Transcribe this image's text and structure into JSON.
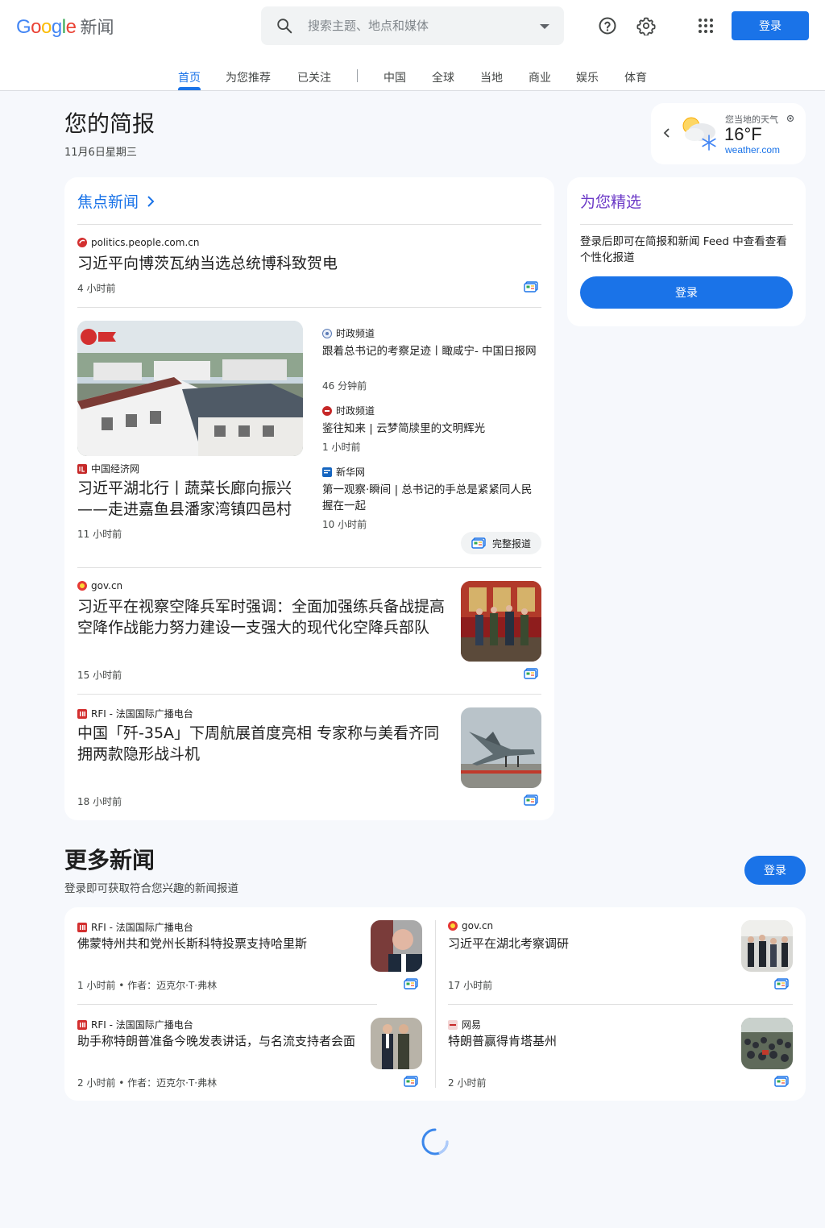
{
  "header": {
    "logo_text": "Google",
    "logo_sub": "新闻",
    "search_placeholder": "搜索主题、地点和媒体",
    "signin_label": "登录"
  },
  "tabs": [
    {
      "label": "首页",
      "active": true
    },
    {
      "label": "为您推荐"
    },
    {
      "label": "已关注"
    },
    {
      "label": "中国"
    },
    {
      "label": "全球"
    },
    {
      "label": "当地"
    },
    {
      "label": "商业"
    },
    {
      "label": "娱乐"
    },
    {
      "label": "体育"
    }
  ],
  "briefing": {
    "title": "您的简报",
    "date": "11月6日星期三"
  },
  "weather": {
    "label": "您当地的天气",
    "temp": "16°F",
    "source": "weather.com"
  },
  "top_stories": {
    "section_label": "焦点新闻",
    "story1": {
      "source": "politics.people.com.cn",
      "headline": "习近平向博茨瓦纳当选总统博科致贺电",
      "time": "4 小时前"
    },
    "cluster": {
      "main": {
        "source": "中国经济网",
        "headline": "习近平湖北行丨蔬菜长廊向振兴——走进嘉鱼县潘家湾镇四邑村",
        "time": "11 小时前"
      },
      "related": [
        {
          "source": "时政频道",
          "headline": "跟着总书记的考察足迹丨瞰咸宁- 中国日报网",
          "time": "46 分钟前"
        },
        {
          "source": "时政频道",
          "headline": "鉴往知来 | 云梦简牍里的文明辉光",
          "time": "1 小时前"
        },
        {
          "source": "新华网",
          "headline": "第一观察·瞬间 | 总书记的手总是紧紧同人民握在一起",
          "time": "10 小时前"
        }
      ],
      "full_coverage": "完整报道"
    },
    "story3": {
      "source": "gov.cn",
      "headline": "习近平在视察空降兵军时强调：全面加强练兵备战提高空降作战能力努力建设一支强大的现代化空降兵部队",
      "time": "15 小时前"
    },
    "story4": {
      "source": "RFI - 法国国际广播电台",
      "headline": "中国「歼-35A」下周航展首度亮相 专家称与美看齐同拥两款隐形战斗机",
      "time": "18 小时前"
    }
  },
  "picks": {
    "title": "为您精选",
    "text": "登录后即可在简报和新闻 Feed 中查看查看个性化报道",
    "button": "登录"
  },
  "more_news": {
    "title": "更多新闻",
    "subtitle": "登录即可获取符合您兴趣的新闻报道",
    "button": "登录",
    "items": [
      {
        "source": "RFI - 法国国际广播电台",
        "headline": "佛蒙特州共和党州长斯科特投票支持哈里斯",
        "time": "1 小时前 • 作者：迈克尔·T·弗林"
      },
      {
        "source": "gov.cn",
        "headline": "习近平在湖北考察调研",
        "time": "17 小时前"
      },
      {
        "source": "RFI - 法国国际广播电台",
        "headline": "助手称特朗普准备今晚发表讲话，与名流支持者会面",
        "time": "2 小时前 • 作者：迈克尔·T·弗林"
      },
      {
        "source": "网易",
        "headline": "特朗普赢得肯塔基州",
        "time": "2 小时前"
      }
    ]
  },
  "colors": {
    "accent": "#1a73e8",
    "picks_title": "#6b39c7",
    "background": "#f6f8fc"
  },
  "icons": [
    "search-icon",
    "help-icon",
    "settings-icon",
    "apps-icon",
    "chevron-right-icon",
    "chevron-left-icon",
    "location-icon",
    "full-coverage-icon",
    "loading-spinner-icon"
  ]
}
